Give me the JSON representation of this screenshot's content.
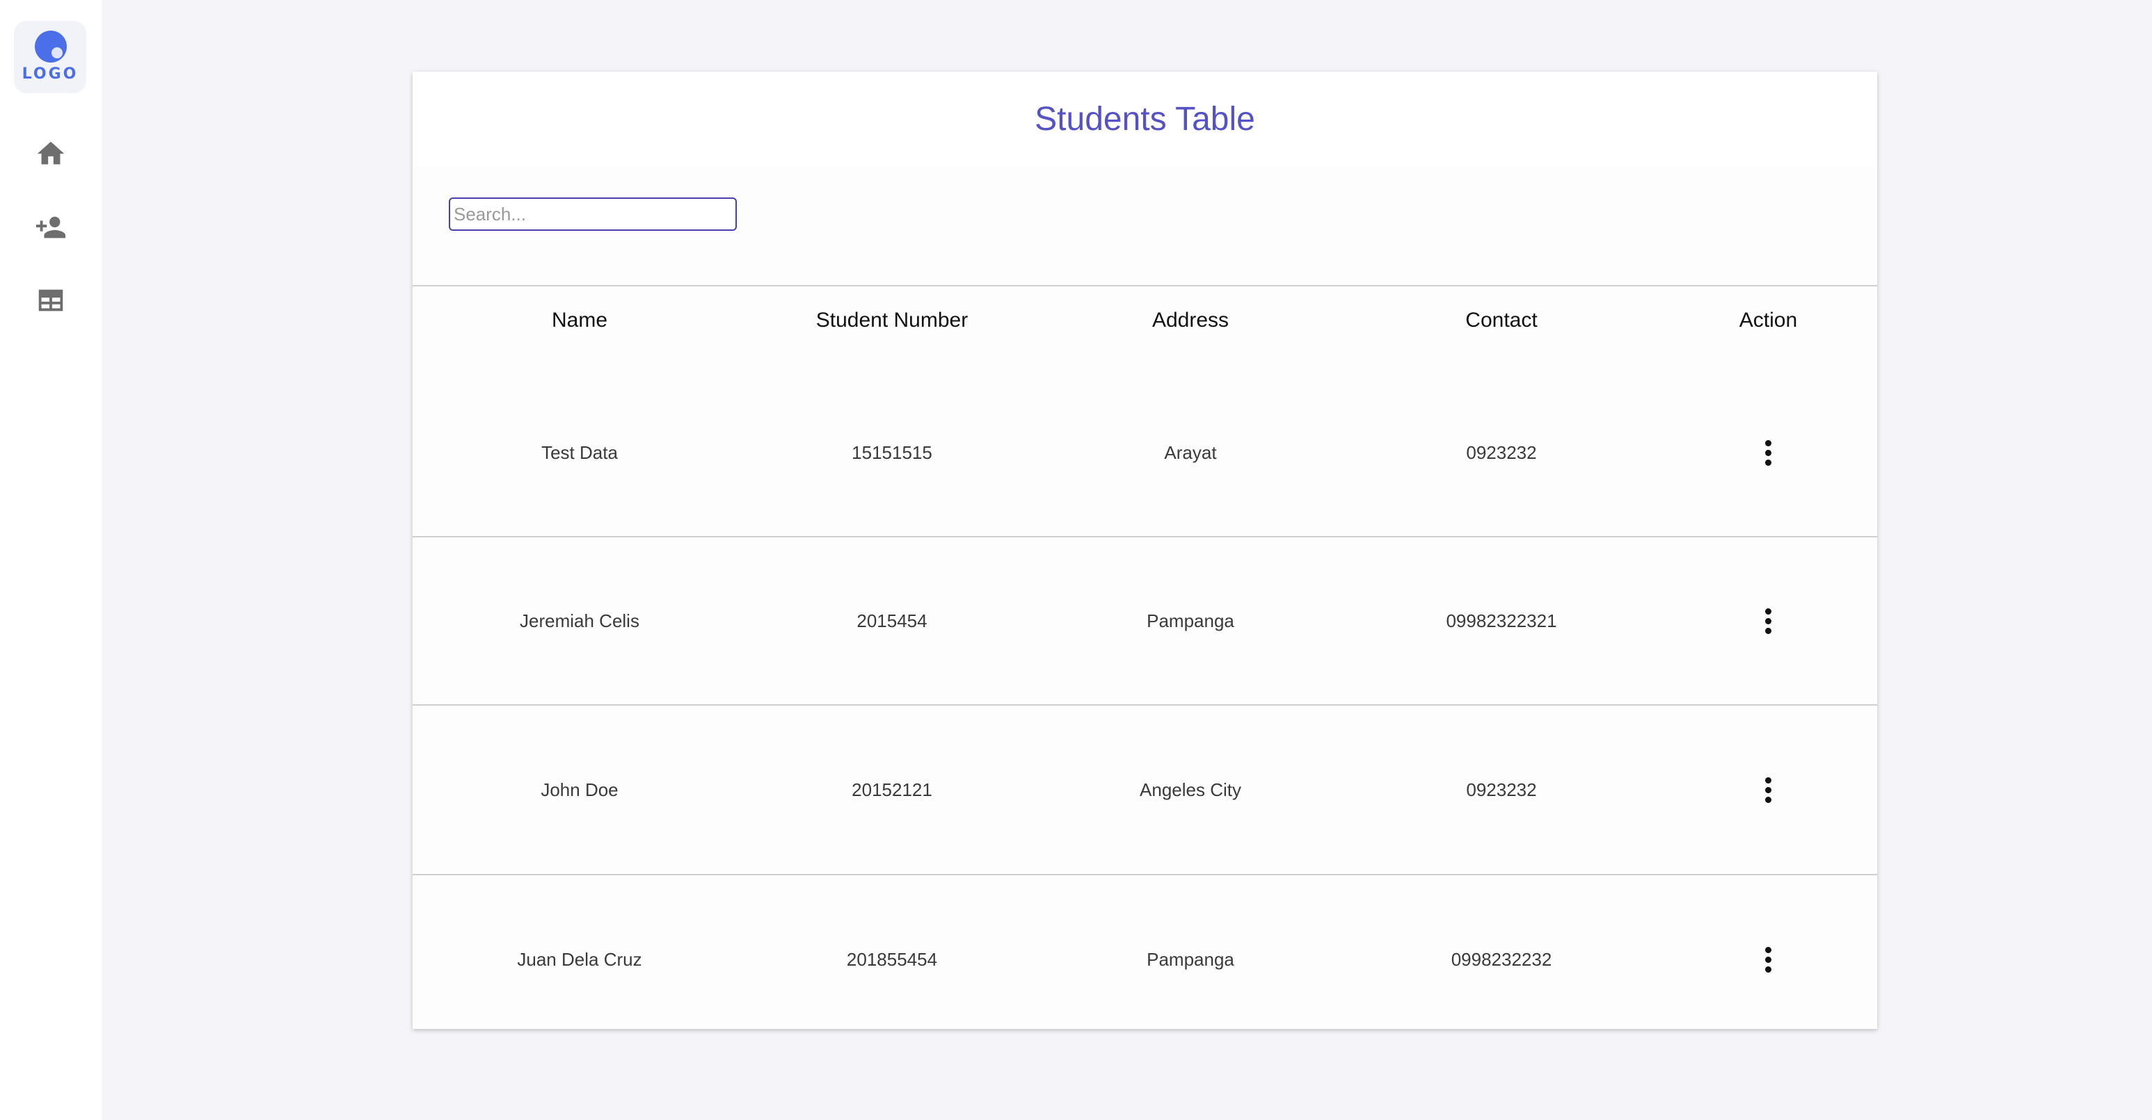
{
  "sidebar": {
    "logo_text": "LOGO",
    "nav": [
      {
        "icon": "home-icon"
      },
      {
        "icon": "add-person-icon"
      },
      {
        "icon": "table-icon"
      }
    ]
  },
  "card": {
    "title": "Students Table",
    "search": {
      "placeholder": "Search...",
      "value": ""
    }
  },
  "table": {
    "columns": [
      "Name",
      "Student Number",
      "Address",
      "Contact",
      "Action"
    ],
    "rows": [
      {
        "name": "Test Data",
        "student_number": "15151515",
        "address": "Arayat",
        "contact": "0923232"
      },
      {
        "name": "Jeremiah Celis",
        "student_number": "2015454",
        "address": "Pampanga",
        "contact": "09982322321"
      },
      {
        "name": "John Doe",
        "student_number": "20152121",
        "address": "Angeles City",
        "contact": "0923232"
      },
      {
        "name": "Juan Dela Cruz",
        "student_number": "201855454",
        "address": "Pampanga",
        "contact": "0998232232"
      }
    ]
  },
  "colors": {
    "accent": "#5553c4",
    "logo": "#4b6fe8",
    "background": "#f4f4f9"
  }
}
